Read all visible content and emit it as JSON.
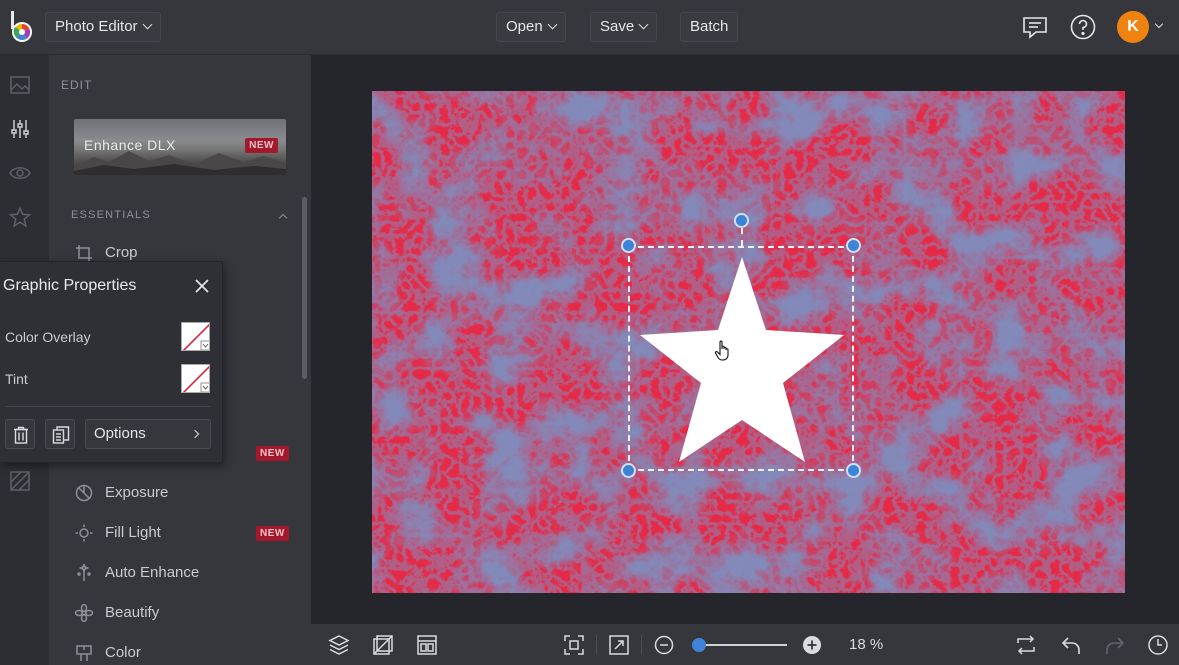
{
  "app": {
    "title": "Photo Editor",
    "menu": {
      "open_label": "Open",
      "save_label": "Save",
      "batch_label": "Batch"
    },
    "user_initial": "K",
    "accent_color": "#3d84d6",
    "avatar_color": "#f0830f",
    "badge_color": "#a3182b"
  },
  "panel": {
    "edit_label": "EDIT",
    "enhance_card": {
      "label": "Enhance DLX",
      "badge": "NEW"
    },
    "section_label": "ESSENTIALS",
    "tools": [
      {
        "label": "Crop",
        "icon": "crop-icon"
      },
      {
        "label": "",
        "badge": "NEW"
      },
      {
        "label": "Exposure",
        "icon": "exposure-icon"
      },
      {
        "label": "Fill Light",
        "icon": "fill-light-icon",
        "badge": "NEW"
      },
      {
        "label": "Auto Enhance",
        "icon": "auto-enhance-icon"
      },
      {
        "label": "Beautify",
        "icon": "beautify-icon"
      },
      {
        "label": "Color",
        "icon": "color-icon"
      }
    ]
  },
  "graphic_properties": {
    "title": "Graphic Properties",
    "color_overlay_label": "Color Overlay",
    "tint_label": "Tint",
    "options_label": "Options"
  },
  "canvas": {
    "photo_color": "#e52a48",
    "shape": "star",
    "shape_color": "#ffffff"
  },
  "bottombar": {
    "zoom_percent": 18,
    "zoom_label": "18 %"
  }
}
